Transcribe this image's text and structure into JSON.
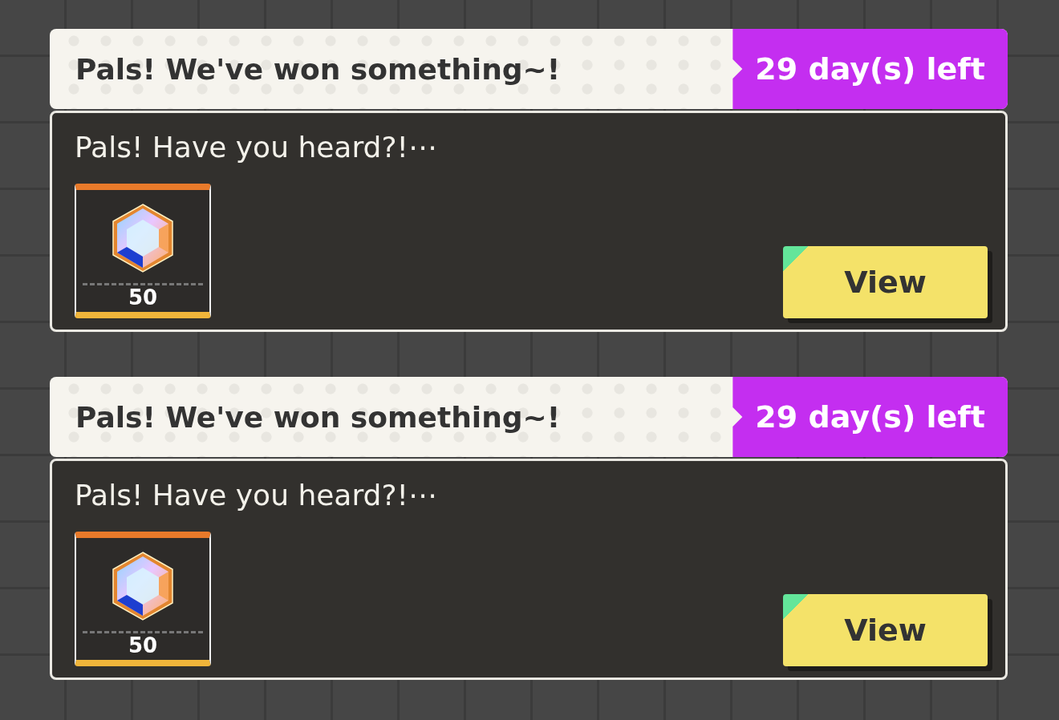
{
  "messages": [
    {
      "title": "Pals! We've won something~!",
      "days_left": "29 day(s) left",
      "preview": "Pals! Have you heard?!⋯",
      "reward": {
        "quantity": "50"
      },
      "button": "View"
    },
    {
      "title": "Pals! We've won something~!",
      "days_left": "29 day(s) left",
      "preview": "Pals! Have you heard?!⋯",
      "reward": {
        "quantity": "50"
      },
      "button": "View"
    }
  ]
}
